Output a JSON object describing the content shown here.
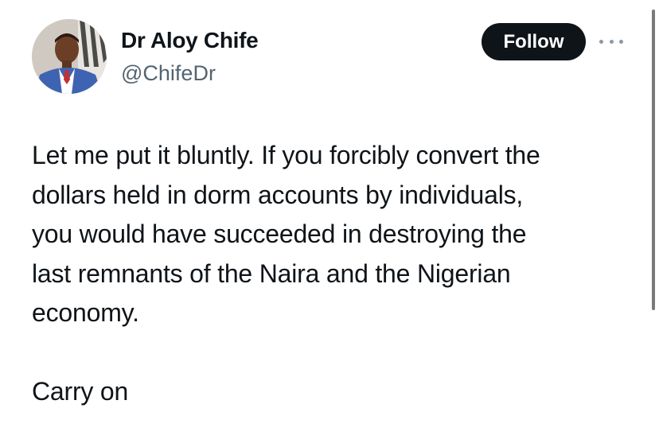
{
  "author": {
    "display_name": "Dr Aloy Chife",
    "handle": "@ChifeDr"
  },
  "actions": {
    "follow_label": "Follow",
    "more_icon": "more-horizontal-icon"
  },
  "tweet": {
    "lines": [
      "Let me put it bluntly. If you forcibly convert the",
      "dollars held in dorm accounts by individuals,",
      "you would have succeeded in destroying the",
      "last remnants of the Naira and the Nigerian",
      "economy."
    ],
    "closing": "Carry on"
  },
  "colors": {
    "text": "#0f1419",
    "secondary_text": "#536471",
    "follow_button_bg": "#0f1419",
    "follow_button_text": "#ffffff",
    "background": "#ffffff"
  }
}
